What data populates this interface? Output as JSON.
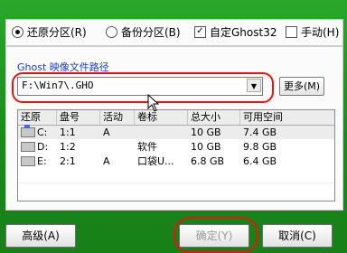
{
  "options": {
    "restore_label": "还原分区(R)",
    "backup_label": "备份分区(B)",
    "custom_ghost_label": "自定Ghost32",
    "manual_label": "手动(H)",
    "restore_selected": true,
    "custom_ghost_checked": true
  },
  "path": {
    "label": "Ghost 映像文件路径",
    "value": "F:\\Win7\\.GHO",
    "more_button": "更多(M)"
  },
  "table": {
    "columns": [
      "还原",
      "盘号",
      "活动",
      "卷标",
      "总大小",
      "可用空间"
    ],
    "rows": [
      {
        "drive": "C:",
        "disk": "1:1",
        "active": "A",
        "label": "",
        "total": "10 GB",
        "free": "7.4 GB",
        "selected": true
      },
      {
        "drive": "D:",
        "disk": "1:2",
        "active": "",
        "label": "软件",
        "total": "10 GB",
        "free": "9.8 GB",
        "selected": false
      },
      {
        "drive": "E:",
        "disk": "2:1",
        "active": "A",
        "label": "口袋U...",
        "total": "6.8 GB",
        "free": "6.4 GB",
        "selected": false
      }
    ]
  },
  "buttons": {
    "advanced": "高级(A)",
    "ok": "确定(Y)",
    "cancel": "取消(C)"
  },
  "colors": {
    "background": "#1f8f1f",
    "annotation": "#e11111",
    "path_label": "#1a40c8"
  }
}
